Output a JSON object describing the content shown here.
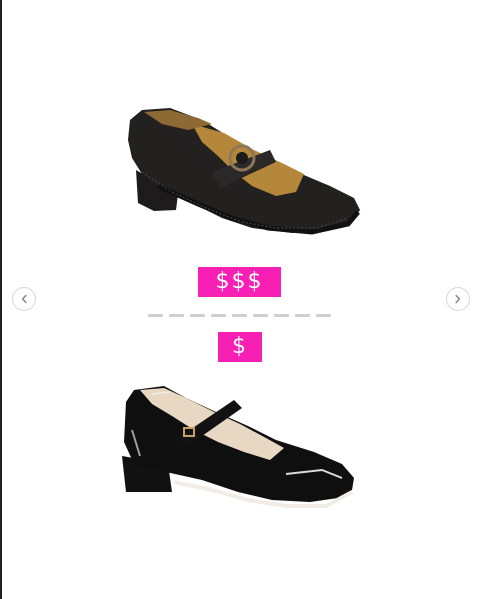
{
  "left_product": {
    "price_level": "$$$",
    "image_icon": "suede-mary-jane-heel-image"
  },
  "right_product": {
    "price_level": "$",
    "image_icon": "patent-mary-jane-block-heel-image"
  },
  "carousel": {
    "prev_icon": "chevron-left-icon",
    "next_icon": "chevron-right-icon",
    "indicator_count": 9
  },
  "colors": {
    "price_badge_bg": "#f71fb4",
    "price_badge_text": "#ffffff",
    "nav_border": "#d8d8d8",
    "indicator": "#cfcfcf",
    "frame_border": "#1f1f1f"
  }
}
